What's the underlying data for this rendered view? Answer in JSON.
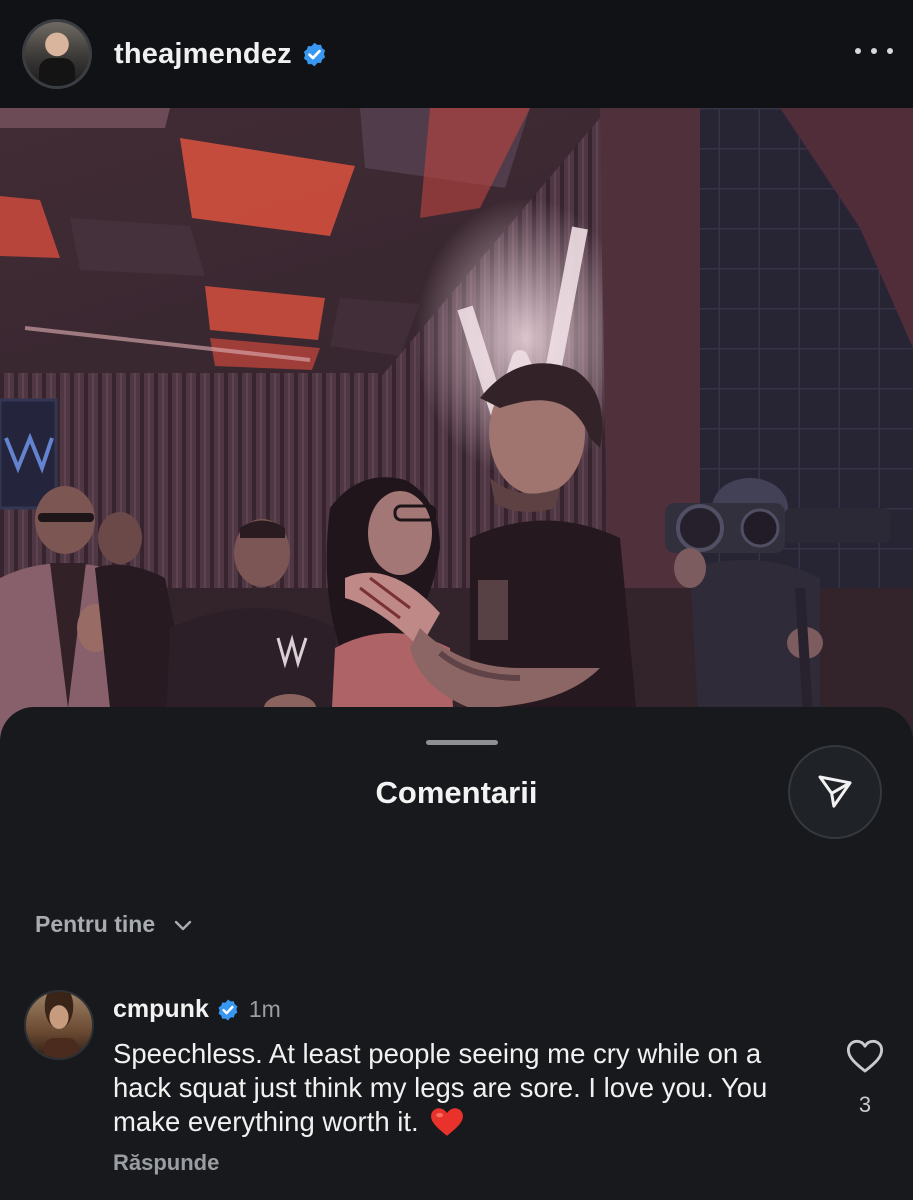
{
  "post": {
    "username": "theajmendez",
    "verified": true
  },
  "photo": {
    "ceiling_accent": "#e0533c",
    "ambient_tint": "#3b2a33"
  },
  "comments_sheet": {
    "title": "Comentarii",
    "filter_label": "Pentru tine",
    "comment": {
      "username": "cmpunk",
      "verified": true,
      "time": "1m",
      "text": "Speechless. At least people seeing me cry while on a hack squat just think my legs are sore. I love you. You make everything worth it.",
      "emoji": "red-heart",
      "reply_label": "Răspunde",
      "like_count": "3"
    }
  },
  "icons": {
    "more": "more-horizontal-icon",
    "verified": "verified-badge-icon",
    "share": "send-paper-plane-icon",
    "chevron": "chevron-down-icon",
    "like": "heart-outline-icon"
  },
  "colors": {
    "background": "#111316",
    "sheet": "#17191c",
    "verified_blue": "#3897f0",
    "secondary_text": "#9a9da2",
    "heart_red": "#e8322b"
  }
}
